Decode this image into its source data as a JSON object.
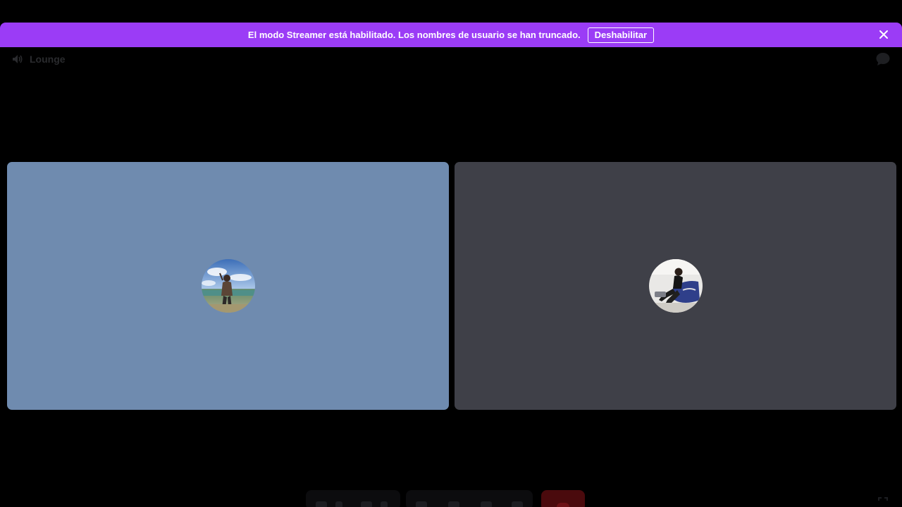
{
  "banner": {
    "message": "El modo Streamer está habilitado. Los nombres de usuario se han truncado.",
    "button_label": "Deshabilitar",
    "close_icon": "close-icon",
    "color": "#9b3cf6"
  },
  "channel": {
    "name": "Lounge",
    "icon": "speaker-icon"
  },
  "header_actions": {
    "chat_icon": "chat-bubble-icon"
  },
  "participants": [
    {
      "tile_color": "#6f8baf",
      "avatar": "avatar-participant-1"
    },
    {
      "tile_color": "#3f4048",
      "avatar": "avatar-participant-2"
    }
  ],
  "controls": {
    "items": [
      "microphone-icon",
      "camera-icon",
      "screen-share-icon",
      "activities-icon",
      "soundboard-icon",
      "more-icon",
      "disconnect-icon",
      "fullscreen-icon"
    ],
    "disconnect_color": "#4a0a0d"
  }
}
